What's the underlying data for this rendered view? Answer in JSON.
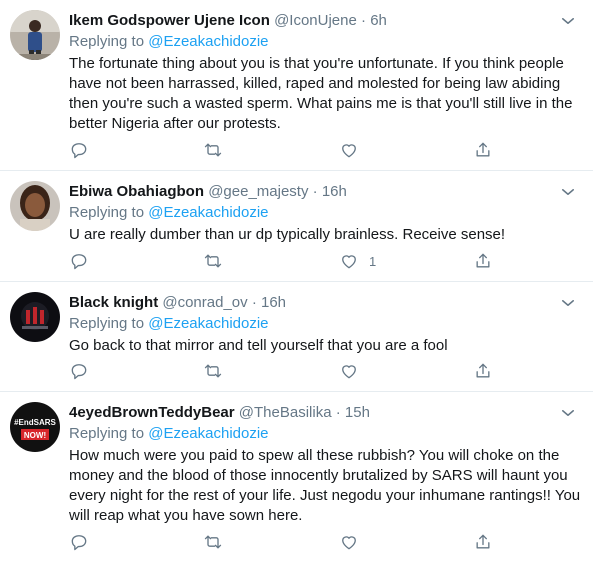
{
  "tweets": [
    {
      "name": "Ikem Godspower Ujene Icon",
      "handle": "@IconUjene",
      "dot": "·",
      "time": "6h",
      "replying_label": "Replying to",
      "replying_to": "@Ezeakachidozie",
      "text": "The fortunate thing about you is that you're unfortunate. If you think people have not been harrassed, killed, raped and molested for being law abiding then you're such a wasted sperm. What pains me is that you'll still live in the better Nigeria after our protests.",
      "like_count": ""
    },
    {
      "name": "Ebiwa Obahiagbon",
      "handle": "@gee_majesty",
      "dot": "·",
      "time": "16h",
      "replying_label": "Replying to",
      "replying_to": "@Ezeakachidozie",
      "text": "U are really dumber than ur dp typically brainless. Receive sense!",
      "like_count": "1"
    },
    {
      "name": "Black knight",
      "handle": "@conrad_ov",
      "dot": "·",
      "time": "16h",
      "replying_label": "Replying to",
      "replying_to": "@Ezeakachidozie",
      "text": "Go back to that mirror and tell yourself that you are a fool",
      "like_count": ""
    },
    {
      "name": "4eyedBrownTeddyBear",
      "handle": "@TheBasilika",
      "dot": "·",
      "time": "15h",
      "replying_label": "Replying to",
      "replying_to": "@Ezeakachidozie",
      "text": "How much were you paid to spew all these rubbish? You will choke on the money and the blood of those innocently brutalized by SARS will haunt you every night for the rest of your life. Just negodu your inhumane rantings!! You will reap what you have sown here.",
      "like_count": "",
      "avatar_text_1": "#EndSARS",
      "avatar_text_2": "NOW!"
    }
  ],
  "icons": {
    "reply": "reply-icon",
    "retweet": "retweet-icon",
    "like": "like-icon",
    "share": "share-icon",
    "caret": "chevron-down-icon"
  },
  "colors": {
    "link": "#1da1f2",
    "secondary_text": "#657786",
    "primary_text": "#14171a",
    "divider": "#e6ecf0"
  }
}
